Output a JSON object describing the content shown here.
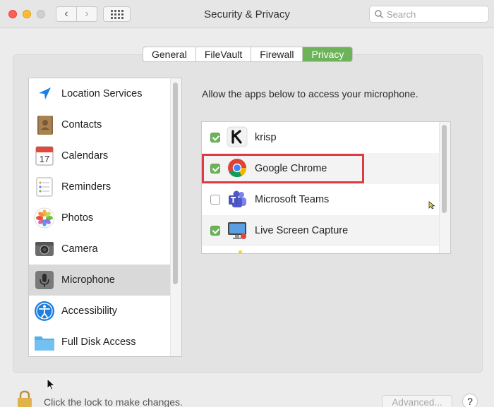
{
  "window": {
    "title": "Security & Privacy"
  },
  "toolbar": {
    "back_icon": "chevron-left-icon",
    "forward_icon": "chevron-right-icon",
    "grid_icon": "grid-icon"
  },
  "search": {
    "placeholder": "Search",
    "icon": "search-icon"
  },
  "tabs": [
    {
      "label": "General",
      "active": false
    },
    {
      "label": "FileVault",
      "active": false
    },
    {
      "label": "Firewall",
      "active": false
    },
    {
      "label": "Privacy",
      "active": true
    }
  ],
  "sidebar": {
    "items": [
      {
        "label": "Location Services",
        "icon": "location-arrow-icon"
      },
      {
        "label": "Contacts",
        "icon": "contacts-book-icon"
      },
      {
        "label": "Calendars",
        "icon": "calendar-icon",
        "icon_text": "17"
      },
      {
        "label": "Reminders",
        "icon": "reminders-list-icon"
      },
      {
        "label": "Photos",
        "icon": "photos-flower-icon"
      },
      {
        "label": "Camera",
        "icon": "camera-icon"
      },
      {
        "label": "Microphone",
        "icon": "microphone-icon",
        "selected": true
      },
      {
        "label": "Accessibility",
        "icon": "accessibility-icon"
      },
      {
        "label": "Full Disk Access",
        "icon": "folder-icon"
      }
    ]
  },
  "main": {
    "description": "Allow the apps below to access your microphone.",
    "apps": [
      {
        "label": "krisp",
        "checked": true,
        "icon": "krisp-icon"
      },
      {
        "label": "Google Chrome",
        "checked": true,
        "icon": "chrome-icon",
        "highlighted": true
      },
      {
        "label": "Microsoft Teams",
        "checked": false,
        "icon": "teams-icon"
      },
      {
        "label": "Live Screen Capture",
        "checked": true,
        "icon": "screen-capture-icon"
      }
    ]
  },
  "footer": {
    "lock_text": "Click the lock to make changes.",
    "advanced_label": "Advanced...",
    "help_label": "?"
  },
  "colors": {
    "accent_green": "#6db35a",
    "highlight_red": "#de3b44"
  }
}
